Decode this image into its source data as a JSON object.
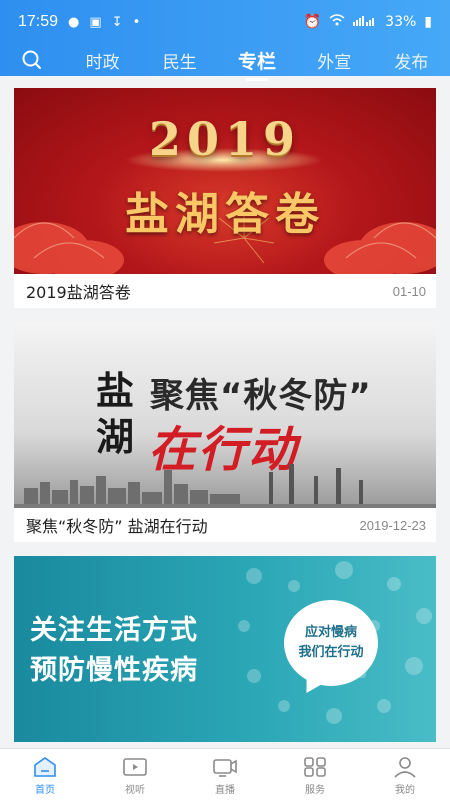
{
  "status_bar": {
    "time": "17:59",
    "battery": "33%"
  },
  "tabs": [
    {
      "label": "时政"
    },
    {
      "label": "民生"
    },
    {
      "label": "专栏",
      "active": true
    },
    {
      "label": "外宣"
    },
    {
      "label": "发布"
    }
  ],
  "colors": {
    "header": "#2f8ff0",
    "active_nav": "#2f8ff0",
    "banner_red": "#b3161a",
    "banner_teal": "#2aa6b5"
  },
  "cards": [
    {
      "banner": {
        "year": "2019",
        "title": "盐湖答卷"
      },
      "caption": "2019盐湖答卷",
      "date": "01-10"
    },
    {
      "banner": {
        "left": "盐湖",
        "line1": "聚焦“秋冬防”",
        "line2": "在行动"
      },
      "caption": "聚焦“秋冬防” 盐湖在行动",
      "date": "2019-12-23"
    },
    {
      "banner": {
        "line1": "关注生活方式",
        "line2": "预防慢性疾病",
        "bubble1": "应对慢病",
        "bubble2": "我们在行动"
      }
    }
  ],
  "bottom_nav": [
    {
      "label": "首页",
      "icon": "home-icon",
      "active": true
    },
    {
      "label": "视听",
      "icon": "video-icon"
    },
    {
      "label": "直播",
      "icon": "live-icon"
    },
    {
      "label": "服务",
      "icon": "grid-icon"
    },
    {
      "label": "我的",
      "icon": "user-icon"
    }
  ]
}
